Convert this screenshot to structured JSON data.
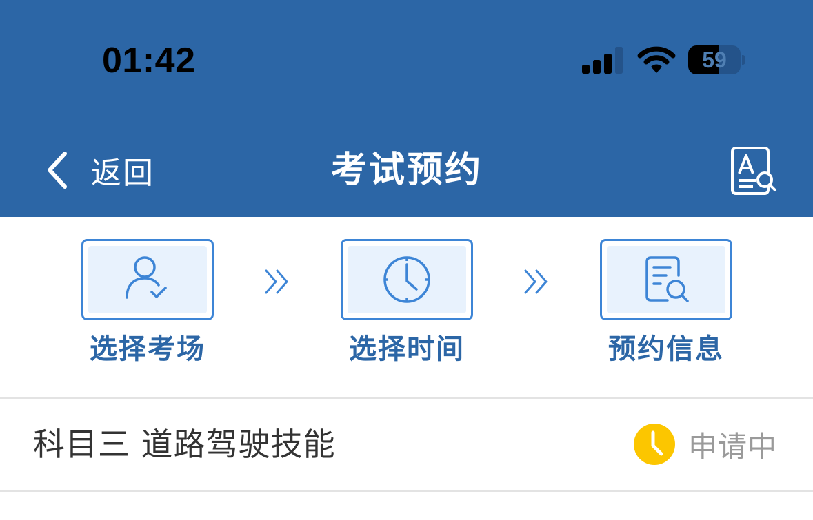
{
  "status_bar": {
    "time": "01:42",
    "battery_level": "59",
    "battery_fraction": 0.59
  },
  "nav": {
    "back_label": "返回",
    "title": "考试预约",
    "right_icon": "document-search-icon"
  },
  "steps": [
    {
      "label": "选择考场",
      "icon": "user-check-icon"
    },
    {
      "label": "选择时间",
      "icon": "clock-icon"
    },
    {
      "label": "预约信息",
      "icon": "document-search-icon"
    }
  ],
  "subject": {
    "name": "科目三 道路驾驶技能",
    "status": "申请中",
    "status_icon": "clock-icon"
  },
  "colors": {
    "header_bg": "#2c66a6",
    "accent": "#3d85d6",
    "step_label": "#2c66a6",
    "step_bg": "#e8f2fd",
    "status_icon": "#fcc600",
    "status_text": "#9a9a9a"
  }
}
